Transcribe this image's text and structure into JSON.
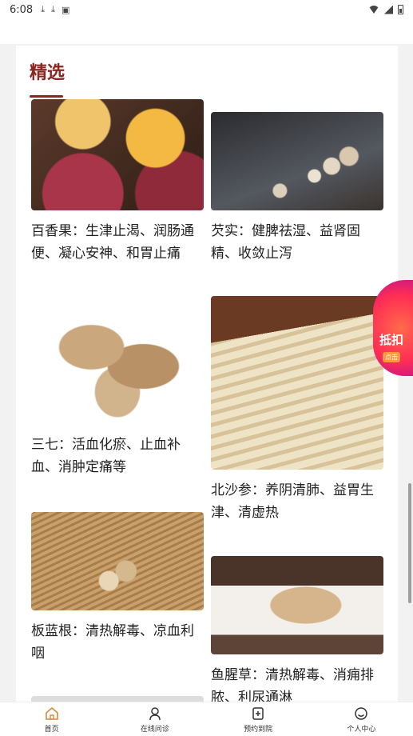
{
  "status_bar": {
    "time": "6:08",
    "icons": [
      "download-icon",
      "download-icon",
      "app-icon"
    ]
  },
  "section": {
    "title": "精选"
  },
  "items": [
    {
      "name": "passion-fruit",
      "caption": "百香果：生津止渴、润肠通便、凝心安神、和胃止痛"
    },
    {
      "name": "qianshi",
      "caption": "芡实：健脾祛湿、益肾固精、收敛止泻"
    },
    {
      "name": "sanqi",
      "caption": "三七：活血化瘀、止血补血、消肿定痛等"
    },
    {
      "name": "beishashen",
      "caption": "北沙参：养阴清肺、益胃生津、清虚热"
    },
    {
      "name": "banlangen",
      "caption": "板蓝根：清热解毒、凉血利咽"
    },
    {
      "name": "yuxingcao",
      "caption": "鱼腥草：清热解毒、消痈排脓、利尿通淋"
    }
  ],
  "promo": {
    "label": "抵扣",
    "sub_label": "点击"
  },
  "tabbar": {
    "tabs": [
      {
        "label": "首页",
        "icon": "home-icon"
      },
      {
        "label": "在线问诊",
        "icon": "doctor-icon"
      },
      {
        "label": "预约到院",
        "icon": "hospital-icon"
      },
      {
        "label": "个人中心",
        "icon": "profile-icon"
      }
    ]
  },
  "colors": {
    "accent": "#8c2420",
    "active_tab": "#d9883b"
  }
}
